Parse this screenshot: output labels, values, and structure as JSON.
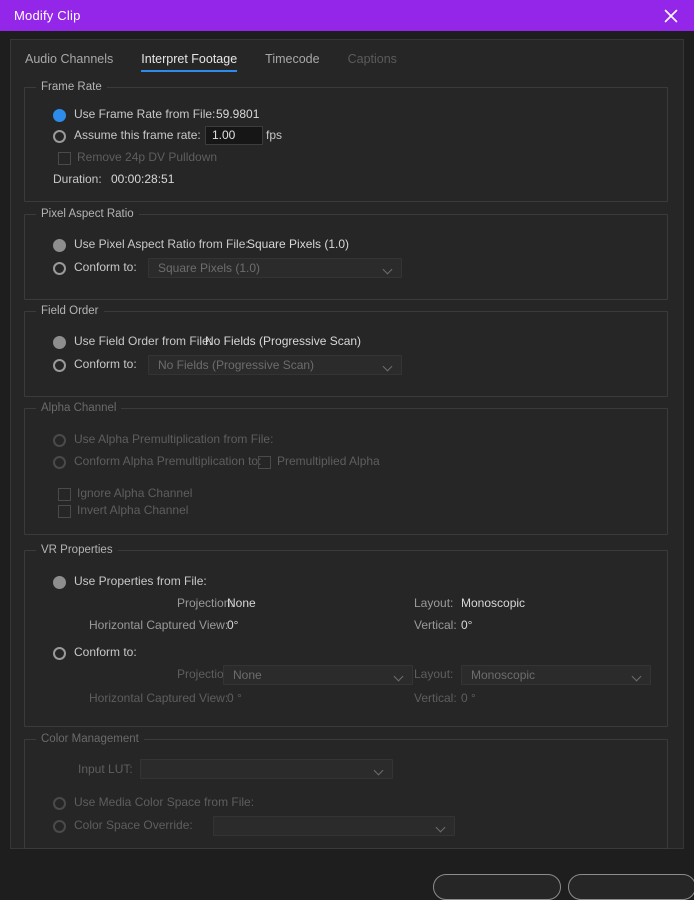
{
  "window": {
    "title": "Modify Clip",
    "close_icon": "close-icon"
  },
  "tabs": [
    {
      "label": "Audio Channels",
      "state": "normal"
    },
    {
      "label": "Interpret Footage",
      "state": "active"
    },
    {
      "label": "Timecode",
      "state": "normal"
    },
    {
      "label": "Captions",
      "state": "disabled"
    }
  ],
  "frame_rate": {
    "group_title": "Frame Rate",
    "use_from_file_label": "Use Frame Rate from File:",
    "use_from_file_value": "59.9801",
    "assume_label": "Assume this frame rate:",
    "assume_value": "1.00",
    "fps_unit": "fps",
    "remove_pulldown_label": "Remove 24p DV Pulldown",
    "duration_label": "Duration:",
    "duration_value": "00:00:28:51"
  },
  "pixel_aspect_ratio": {
    "group_title": "Pixel Aspect Ratio",
    "use_from_file_label": "Use Pixel Aspect Ratio from File:",
    "use_from_file_value": "Square Pixels (1.0)",
    "conform_label": "Conform to:",
    "conform_value": "Square Pixels (1.0)"
  },
  "field_order": {
    "group_title": "Field Order",
    "use_from_file_label": "Use Field Order from File:",
    "use_from_file_value": "No Fields (Progressive Scan)",
    "conform_label": "Conform to:",
    "conform_value": "No Fields (Progressive Scan)"
  },
  "alpha_channel": {
    "group_title": "Alpha Channel",
    "use_premultiplication_label": "Use Alpha Premultiplication from File:",
    "conform_premultiplication_label": "Conform Alpha Premultiplication to:",
    "premultiplied_alpha_label": "Premultiplied Alpha",
    "ignore_alpha_label": "Ignore Alpha Channel",
    "invert_alpha_label": "Invert Alpha Channel"
  },
  "vr_properties": {
    "group_title": "VR Properties",
    "use_from_file_label": "Use Properties from File:",
    "file_projection_label": "Projection:",
    "file_projection_value": "None",
    "file_layout_label": "Layout:",
    "file_layout_value": "Monoscopic",
    "file_hcv_label": "Horizontal Captured View:",
    "file_hcv_value": "0°",
    "file_vertical_label": "Vertical:",
    "file_vertical_value": "0°",
    "conform_label": "Conform to:",
    "conform_projection_label": "Projection:",
    "conform_projection_value": "None",
    "conform_layout_label": "Layout:",
    "conform_layout_value": "Monoscopic",
    "conform_hcv_label": "Horizontal Captured View:",
    "conform_hcv_value": "0 °",
    "conform_vertical_label": "Vertical:",
    "conform_vertical_value": "0 °"
  },
  "color_management": {
    "group_title": "Color Management",
    "input_lut_label": "Input LUT:",
    "input_lut_value": "",
    "use_media_color_space_label": "Use Media Color Space from File:",
    "color_space_override_label": "Color Space Override:",
    "color_space_override_value": ""
  },
  "footer": {
    "cancel_label": "",
    "ok_label": ""
  },
  "colors": {
    "title_bar": "#9326e8",
    "accent": "#2d8ceb",
    "panel_bg": "#262626",
    "dialog_bg": "#1e1e1e"
  }
}
